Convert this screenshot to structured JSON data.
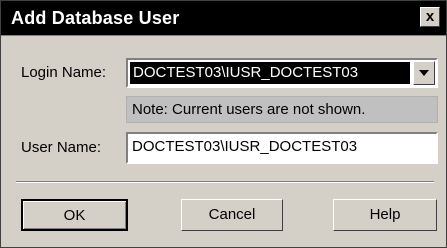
{
  "dialog": {
    "title": "Add Database User",
    "close_label": "x"
  },
  "form": {
    "login_label": "Login Name:",
    "login_value": "DOCTEST03\\IUSR_DOCTEST03",
    "note": "Note: Current users are not shown.",
    "user_label": "User Name:",
    "user_value": "DOCTEST03\\IUSR_DOCTEST03"
  },
  "buttons": {
    "ok": "OK",
    "cancel": "Cancel",
    "help": "Help"
  },
  "icons": {
    "close": "close-icon",
    "dropdown": "chevron-down-icon"
  }
}
